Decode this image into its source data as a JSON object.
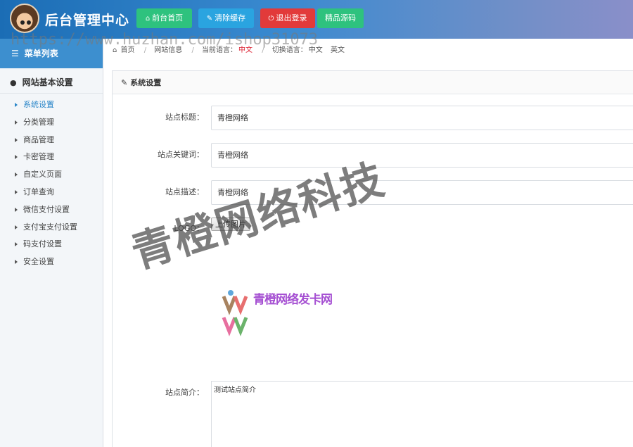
{
  "header": {
    "brand": "后台管理中心",
    "buttons": [
      {
        "label": "前台首页",
        "icon": "home-icon"
      },
      {
        "label": "清除缓存",
        "icon": "wrench-icon"
      },
      {
        "label": "退出登录",
        "icon": "power-icon"
      },
      {
        "label": "精品源码",
        "icon": ""
      }
    ],
    "colors": {
      "home": "#2ec27e",
      "cache": "#2aa4e0",
      "logout": "#e23a3a",
      "source": "#2ec27e"
    }
  },
  "watermark_url": "https://www.huzhan.com/ishop31073",
  "watermark_text": "青橙网络科技",
  "sidebar": {
    "title": "菜单列表",
    "group": "网站基本设置",
    "items": [
      {
        "label": "系统设置",
        "active": true
      },
      {
        "label": "分类管理"
      },
      {
        "label": "商品管理"
      },
      {
        "label": "卡密管理"
      },
      {
        "label": "自定义页面"
      },
      {
        "label": "订单查询"
      },
      {
        "label": "微信支付设置"
      },
      {
        "label": "支付宝支付设置"
      },
      {
        "label": "码支付设置"
      },
      {
        "label": "安全设置"
      }
    ]
  },
  "breadcrumb": {
    "home": "首页",
    "site_info": "网站信息",
    "current_lang_label": "当前语言：",
    "current_lang": "中文",
    "switch_label": "切换语言：",
    "lang_zh": "中文",
    "lang_en": "英文"
  },
  "panel": {
    "title": "系统设置",
    "fields": {
      "site_title": {
        "label": "站点标题：",
        "value": "青橙网络"
      },
      "site_keywords": {
        "label": "站点关键词：",
        "value": "青橙网络"
      },
      "site_description": {
        "label": "站点描述：",
        "value": "青橙网络"
      },
      "logo": {
        "label": "LOGO：",
        "button": "上传图片"
      },
      "site_intro": {
        "label": "站点简介：",
        "value": "测试站点简介"
      }
    },
    "logo_text": "青橙网络发卡网"
  }
}
